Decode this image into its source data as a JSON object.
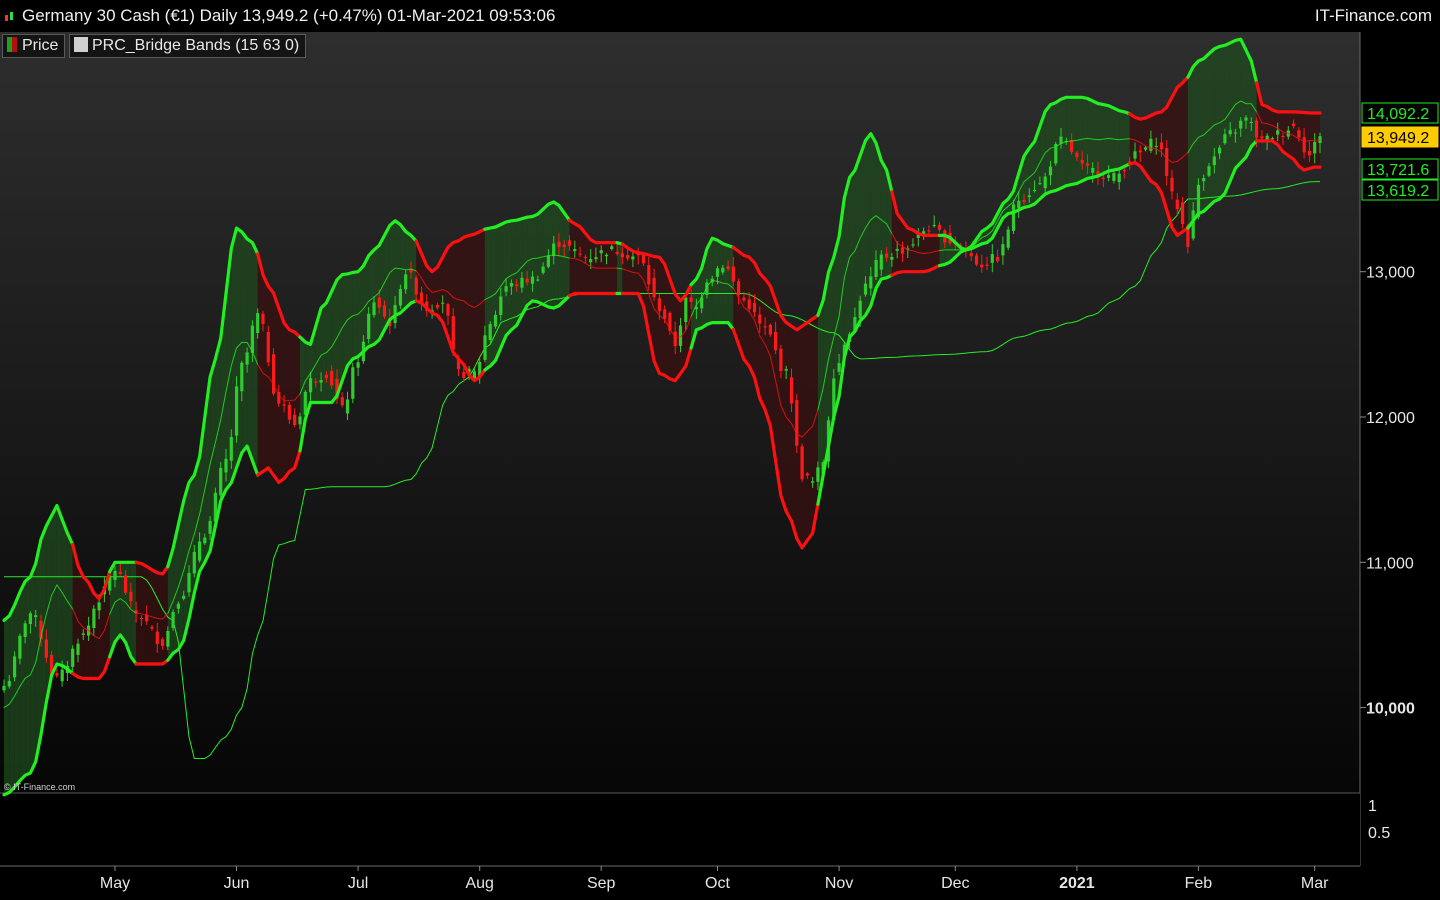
{
  "header": {
    "title": "Germany 30 Cash (€1) Daily 13,949.2 (+0.47%) 01-Mar-2021 09:53:06",
    "brand": "IT-Finance.com"
  },
  "legend": {
    "price_label": "Price",
    "indicator_label": "PRC_Bridge Bands (15 63 0)"
  },
  "copyright": "© IT-Finance.com",
  "colors": {
    "bull": "#2ecc2e",
    "bear": "#ff1a1a",
    "band_green": "#22ee22",
    "band_red": "#ff1010",
    "price_tag": "#ffcc00",
    "fill_green": "#1f4a1f",
    "fill_red": "#3a1010"
  },
  "chart_data": {
    "type": "candlestick",
    "instrument": "Germany 30 Cash (€1)",
    "timeframe": "Daily",
    "last_price": 13949.2,
    "change_pct": 0.47,
    "y_axis": {
      "ticks": [
        "10,000",
        "11,000",
        "12,000",
        "13,000"
      ],
      "tick_values": [
        10000,
        11000,
        12000,
        13000
      ],
      "ylim": [
        9450,
        14600
      ]
    },
    "x_axis": {
      "labels": [
        "May",
        "Jun",
        "Jul",
        "Aug",
        "Sep",
        "Oct",
        "Nov",
        "Dec",
        "2021",
        "Feb",
        "Mar"
      ],
      "label_index": [
        21,
        44,
        67,
        90,
        113,
        135,
        158,
        180,
        203,
        226,
        248
      ]
    },
    "value_tags": [
      {
        "label": "14,092.2",
        "value": 14092.2,
        "kind": "upper-band"
      },
      {
        "label": "13,949.2",
        "value": 13949.2,
        "kind": "price"
      },
      {
        "label": "13,721.6",
        "value": 13721.6,
        "kind": "lower-band"
      },
      {
        "label": "13,619.2",
        "value": 13619.2,
        "kind": "stop-line"
      }
    ],
    "price_path": {
      "idx": [
        0,
        5,
        10,
        15,
        18,
        21,
        25,
        30,
        33,
        38,
        42,
        45,
        48,
        52,
        55,
        58,
        61,
        64,
        67,
        70,
        73,
        76,
        80,
        83,
        86,
        89,
        92,
        95,
        100,
        105,
        110,
        115,
        120,
        124,
        127,
        129,
        131,
        133,
        136,
        140,
        144,
        148,
        151,
        153,
        155,
        157,
        160,
        163,
        166,
        170,
        175,
        180,
        185,
        188,
        192,
        196,
        200,
        205,
        210,
        214,
        218,
        222,
        224,
        226,
        228,
        232,
        235,
        238,
        241,
        244,
        247,
        249
      ],
      "close": [
        10150,
        10650,
        10200,
        10500,
        10750,
        10950,
        10650,
        10450,
        10750,
        11200,
        11700,
        12350,
        12700,
        12100,
        11950,
        12250,
        12300,
        12050,
        12400,
        12800,
        12650,
        13000,
        12750,
        12800,
        12300,
        12300,
        12650,
        12900,
        12950,
        13200,
        13100,
        13150,
        13100,
        12750,
        12500,
        12800,
        12750,
        12950,
        13050,
        12800,
        12600,
        12300,
        11600,
        11550,
        11700,
        12300,
        12600,
        12900,
        13100,
        13150,
        13300,
        13200,
        13050,
        13100,
        13500,
        13600,
        13900,
        13700,
        13650,
        13800,
        13900,
        13450,
        13200,
        13600,
        13750,
        13950,
        14050,
        13900,
        13950,
        14000,
        13800,
        13950
      ]
    },
    "upper_band_path": {
      "idx": [
        0,
        5,
        8,
        10,
        12,
        15,
        18,
        21,
        25,
        30,
        36,
        40,
        44,
        47,
        50,
        54,
        58,
        60,
        64,
        67,
        70,
        74,
        77,
        81,
        85,
        88,
        92,
        96,
        100,
        104,
        108,
        112,
        116,
        120,
        124,
        128,
        131,
        134,
        137,
        141,
        144,
        148,
        150,
        152,
        154,
        157,
        160,
        164,
        167,
        169,
        171,
        174,
        178,
        182,
        186,
        190,
        194,
        198,
        201,
        204,
        208,
        212,
        215,
        219,
        223,
        226,
        230,
        234,
        236,
        238,
        241,
        244,
        248
      ],
      "value": [
        10600,
        10900,
        11250,
        11390,
        11200,
        10900,
        10750,
        11000,
        11000,
        10920,
        11600,
        12400,
        13300,
        13200,
        12900,
        12600,
        12500,
        12750,
        12980,
        13000,
        13150,
        13350,
        13250,
        13000,
        13200,
        13250,
        13300,
        13350,
        13380,
        13480,
        13330,
        13200,
        13200,
        13130,
        13100,
        12800,
        12950,
        13230,
        13180,
        13100,
        12950,
        12650,
        12600,
        12650,
        12700,
        13100,
        13650,
        13950,
        13700,
        13400,
        13300,
        13250,
        13250,
        13150,
        13300,
        13500,
        13850,
        14150,
        14200,
        14200,
        14150,
        14100,
        14050,
        14100,
        14300,
        14450,
        14550,
        14600,
        14450,
        14150,
        14100,
        14100,
        14092
      ]
    },
    "lower_band_path": {
      "idx": [
        0,
        5,
        10,
        15,
        18,
        22,
        25,
        30,
        33,
        38,
        42,
        46,
        48,
        50,
        52,
        55,
        58,
        62,
        66,
        70,
        74,
        78,
        82,
        86,
        89,
        92,
        96,
        100,
        104,
        108,
        112,
        116,
        120,
        124,
        127,
        129,
        131,
        134,
        137,
        141,
        144,
        148,
        151,
        153,
        155,
        157,
        160,
        163,
        166,
        170,
        174,
        178,
        182,
        186,
        190,
        194,
        198,
        202,
        206,
        210,
        214,
        218,
        222,
        224,
        226,
        230,
        234,
        237,
        240,
        243,
        246,
        248
      ],
      "value": [
        9400,
        9550,
        10300,
        10200,
        10200,
        10500,
        10300,
        10300,
        10400,
        11000,
        11500,
        11800,
        11600,
        11650,
        11550,
        11650,
        12100,
        12100,
        12400,
        12500,
        12700,
        12800,
        12700,
        12400,
        12250,
        12350,
        12600,
        12800,
        12750,
        12850,
        12850,
        12850,
        12850,
        12300,
        12250,
        12350,
        12600,
        12650,
        12650,
        12350,
        12050,
        11350,
        11100,
        11200,
        11600,
        12000,
        12550,
        12700,
        12950,
        13000,
        13000,
        13050,
        13150,
        13200,
        13400,
        13450,
        13550,
        13600,
        13650,
        13700,
        13750,
        13600,
        13250,
        13300,
        13400,
        13500,
        13750,
        13900,
        13900,
        13800,
        13700,
        13720
      ]
    },
    "stop_line_path": {
      "idx": [
        0,
        26,
        32,
        36,
        38,
        42,
        45,
        48,
        52,
        55,
        57,
        62,
        72,
        77,
        80,
        84,
        87,
        92,
        94,
        96,
        100,
        104,
        110,
        120,
        130,
        140,
        148,
        157,
        162,
        168,
        172,
        178,
        186,
        192,
        197,
        202,
        206,
        210,
        214,
        218,
        221,
        224,
        232,
        240,
        248
      ],
      "value": [
        10900,
        10900,
        10600,
        9650,
        9650,
        9800,
        10000,
        10500,
        11120,
        11150,
        11500,
        11520,
        11520,
        11570,
        11720,
        12150,
        12250,
        12500,
        12650,
        12680,
        12750,
        12810,
        12850,
        12850,
        12850,
        12850,
        12700,
        12580,
        12400,
        12410,
        12420,
        12430,
        12450,
        12550,
        12600,
        12650,
        12700,
        12800,
        12900,
        13150,
        13350,
        13500,
        13520,
        13570,
        13620
      ]
    }
  }
}
